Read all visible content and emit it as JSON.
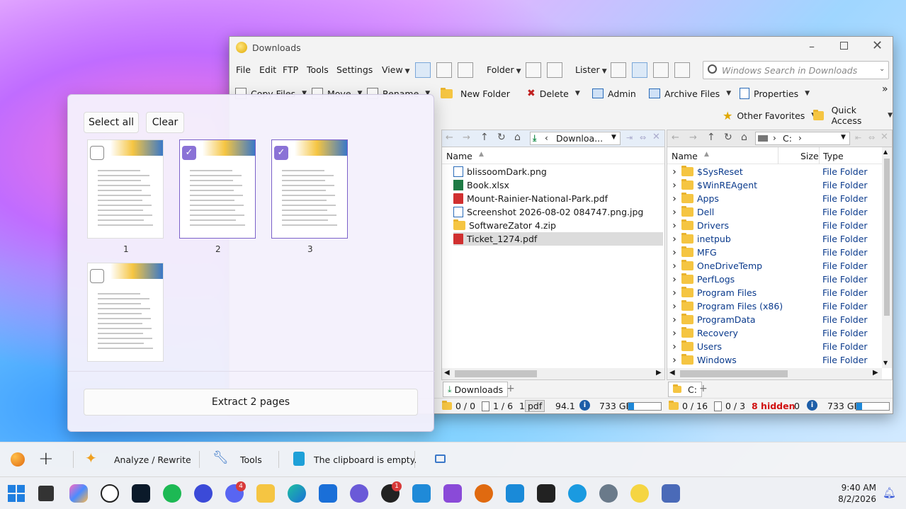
{
  "window": {
    "title": "Downloads"
  },
  "menu": {
    "items": [
      "File",
      "Edit",
      "FTP",
      "Tools",
      "Settings"
    ],
    "view": "View",
    "folder": "Folder",
    "lister": "Lister",
    "search_placeholder": "Windows Search in Downloads"
  },
  "toolbar": {
    "copy": "Copy Files",
    "move": "Move",
    "rename": "Rename",
    "new_folder": "New Folder",
    "delete": "Delete",
    "admin": "Admin",
    "archive": "Archive Files",
    "properties": "Properties",
    "overflow": "»"
  },
  "toolbar2": {
    "favorites": "Other Favorites",
    "quick_access": "Quick Access"
  },
  "left_pane": {
    "path": "Downloa...",
    "header_name": "Name",
    "files": [
      {
        "name": "blissoomDark.png",
        "type": "img"
      },
      {
        "name": "Book.xlsx",
        "type": "xls"
      },
      {
        "name": "Mount-Rainier-National-Park.pdf",
        "type": "pdf"
      },
      {
        "name": "Screenshot 2026-08-02 084747.png.jpg",
        "type": "img"
      },
      {
        "name": "SoftwareZator 4.zip",
        "type": "zip"
      },
      {
        "name": "Ticket_1274.pdf",
        "type": "pdf"
      }
    ],
    "tab": "Downloads",
    "tab_add": "+",
    "status": {
      "folders": "0 / 0",
      "files": "1 / 6",
      "sel_count": "1",
      "filter": "pdf",
      "size": "94.1",
      "free": "733 GB"
    }
  },
  "right_pane": {
    "path": "C:",
    "path_sep": "›",
    "header_name": "Name",
    "header_size": "Size",
    "header_type": "Type",
    "folders": [
      "$SysReset",
      "$WinREAgent",
      "Apps",
      "Dell",
      "Drivers",
      "inetpub",
      "MFG",
      "OneDriveTemp",
      "PerfLogs",
      "Program Files",
      "Program Files (x86)",
      "ProgramData",
      "Recovery",
      "Users",
      "Windows"
    ],
    "folder_type": "File Folder",
    "tab": "C:",
    "tab_add": "+",
    "status": {
      "folders": "0 / 16",
      "files": "0 / 3",
      "hidden": "8 hidden",
      "zero": "0",
      "free": "733 GB"
    }
  },
  "popup": {
    "select_all": "Select all",
    "clear": "Clear",
    "pages": [
      {
        "num": "1",
        "checked": false
      },
      {
        "num": "2",
        "checked": true
      },
      {
        "num": "3",
        "checked": true
      },
      {
        "num": "",
        "checked": false
      }
    ],
    "extract": "Extract 2 pages"
  },
  "clipbar": {
    "analyze": "Analyze / Rewrite",
    "tools": "Tools",
    "clipboard": "The clipboard is empty."
  },
  "taskbar": {
    "time": "9:40 AM",
    "date": "8/2/2026",
    "badge_discord": "4",
    "badge_github": "1"
  },
  "colors": {
    "accent": "#0a6cc4",
    "folder": "#f5c542",
    "pdf": "#d03030",
    "hidden": "#d01010",
    "check": "#8a72d6"
  }
}
